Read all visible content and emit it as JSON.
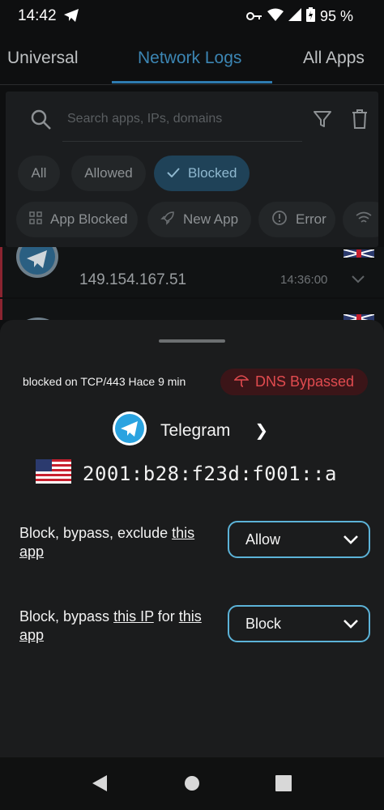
{
  "status_bar": {
    "time": "14:42",
    "battery": "95 %"
  },
  "tabs": [
    {
      "label": "Universal"
    },
    {
      "label": "Network Logs"
    },
    {
      "label": "All Apps"
    }
  ],
  "search": {
    "placeholder": "Search apps, IPs, domains"
  },
  "filters": {
    "status": [
      "All",
      "Allowed",
      "Blocked"
    ],
    "categories": [
      "App Blocked",
      "New App",
      "Error"
    ]
  },
  "log_rows": [
    {
      "ip": "149.154.167.51",
      "time": "14:36:00"
    }
  ],
  "sheet": {
    "protocol_text": "blocked on TCP/443 Hace 9 min",
    "badge": "DNS Bypassed",
    "app_name": "Telegram",
    "chevron": "❯",
    "flag": "🇺🇸",
    "ip": "2001:b28:f23d:f001::a",
    "rule1": {
      "pre": "Block, bypass, exclude ",
      "link1": "this",
      "post": " ",
      "link2": "app",
      "value": "Allow"
    },
    "rule2": {
      "pre": "Block, bypass ",
      "link1": "this IP",
      "mid": " for ",
      "link2": "this",
      "post": " ",
      "link3": "app",
      "value": "Block"
    }
  },
  "colors": {
    "accent": "#3c86b4",
    "danger": "#e14b4f",
    "dropdown_border": "#5cb3d8",
    "telegram": "#2aa3e0"
  }
}
